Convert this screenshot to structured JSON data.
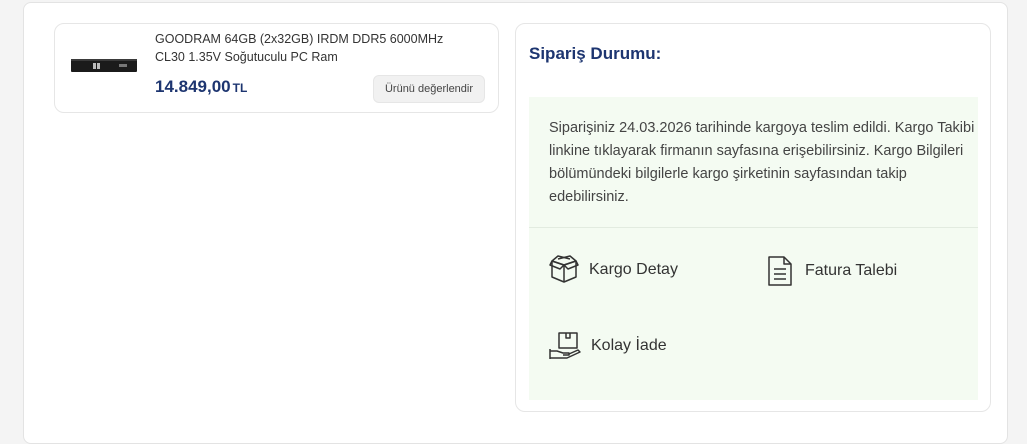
{
  "product": {
    "name": "GOODRAM 64GB (2x32GB) IRDM DDR5 6000MHz CL30 1.35V Soğutuculu PC Ram",
    "price": "14.849,00",
    "currency": "TL",
    "review_button": "Ürünü değerlendir"
  },
  "order_status": {
    "title": "Sipariş Durumu:",
    "message": "Siparişiniz 24.03.2026 tarihinde kargoya teslim edildi. Kargo Takibi linkine tıklayarak firmanın sayfasına erişebilirsiniz. Kargo Bilgileri bölümündeki bilgilerle kargo şirketinin sayfasından takip edebilirsiniz.",
    "actions": [
      {
        "label": "Kargo Detay",
        "icon": "box-icon"
      },
      {
        "label": "Fatura Talebi",
        "icon": "document-icon"
      },
      {
        "label": "Kolay İade",
        "icon": "return-box-icon"
      }
    ]
  },
  "colors": {
    "accent": "#1d3570",
    "panel_bg": "#f4fbf2"
  }
}
